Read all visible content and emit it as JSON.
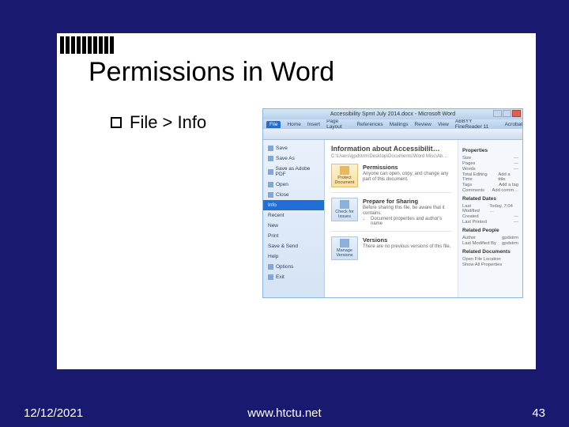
{
  "slide": {
    "title": "Permissions in Word",
    "bullet": "File > Info"
  },
  "word": {
    "window_title": "Accessibility Spmt July 2014.docx - Microsoft Word",
    "tabs": [
      "File",
      "Home",
      "Insert",
      "Page Layout",
      "References",
      "Mailings",
      "Review",
      "View",
      "ABBYY FineReader 11",
      "Acrobat"
    ],
    "backstage": {
      "save": "Save",
      "save_as": "Save As",
      "save_adobe": "Save as Adobe PDF",
      "open": "Open",
      "close": "Close",
      "info": "Info",
      "recent": "Recent",
      "new": "New",
      "print": "Print",
      "save_send": "Save & Send",
      "help": "Help",
      "options": "Options",
      "exit": "Exit"
    },
    "info": {
      "heading": "Information about Accessibilit…",
      "path": "C:\\Users\\gpdstrm\\Desktop\\Documents\\Word Misc\\Ab…",
      "permissions": {
        "title": "Permissions",
        "desc": "Anyone can open, copy, and change any part of this document.",
        "button": "Protect Document"
      },
      "prepare": {
        "title": "Prepare for Sharing",
        "desc": "Before sharing this file, be aware that it contains:",
        "item": "Document properties and author's name",
        "button": "Check for Issues"
      },
      "versions": {
        "title": "Versions",
        "desc": "There are no previous versions of this file.",
        "button": "Manage Versions"
      }
    },
    "props": {
      "heading": "Properties",
      "size_l": "Size",
      "size_v": "---",
      "pages_l": "Pages",
      "pages_v": "---",
      "words_l": "Words",
      "words_v": "---",
      "edit_l": "Total Editing Time",
      "edit_v": "Add a title",
      "tags_l": "Tags",
      "tags_v": "Add a tag",
      "comments_l": "Comments",
      "comments_v": "Add comm…",
      "dates_h": "Related Dates",
      "mod_l": "Last Modified",
      "mod_v": "Today, 7:04 …",
      "created_l": "Created",
      "created_v": "---",
      "printed_l": "Last Printed",
      "printed_v": "---",
      "people_h": "Related People",
      "author_l": "Author",
      "author_v": "gpdstrm",
      "modby_l": "Last Modified By",
      "modby_v": "gpdstrm",
      "docs_h": "Related Documents",
      "openloc": "Open File Location",
      "showall": "Show All Properties"
    }
  },
  "footer": {
    "date": "12/12/2021",
    "url": "www.htctu.net",
    "page": "43"
  }
}
